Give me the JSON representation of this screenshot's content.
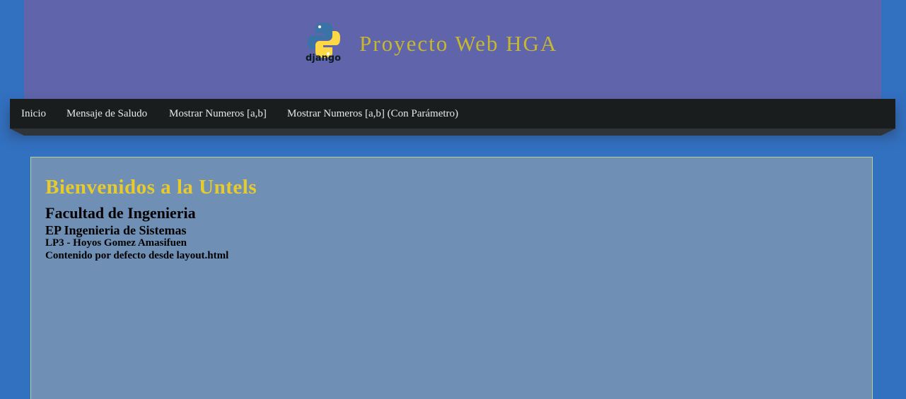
{
  "header": {
    "logo": {
      "icon": "django-python-logo-icon",
      "text": "django"
    },
    "title": "Proyecto Web HGA"
  },
  "nav": {
    "items": [
      {
        "label": "Inicio"
      },
      {
        "label": "Mensaje de Saludo"
      },
      {
        "label": "Mostrar Numeros [a,b]"
      },
      {
        "label": "Mostrar Numeros [a,b] (Con Parámetro)"
      }
    ]
  },
  "content": {
    "welcome": "Bienvenidos a la Untels",
    "faculty": "Facultad de Ingenieria",
    "school": "EP Ingenieria de Sistemas",
    "course": "LP3 - Hoyos Gomez Amasifuen",
    "default_text": "Contenido por defecto desde layout.html"
  },
  "colors": {
    "page_background": "#3270c0",
    "header_background": "#6064ab",
    "title_color": "#c6b732",
    "nav_background": "#1a1d1e",
    "nav_text": "#e8e8e8",
    "content_background": "#6f8fb5",
    "content_border": "#b9d38c",
    "welcome_color": "#e7cb2c",
    "python_blue": "#3a73a5",
    "python_yellow": "#ffd845"
  }
}
